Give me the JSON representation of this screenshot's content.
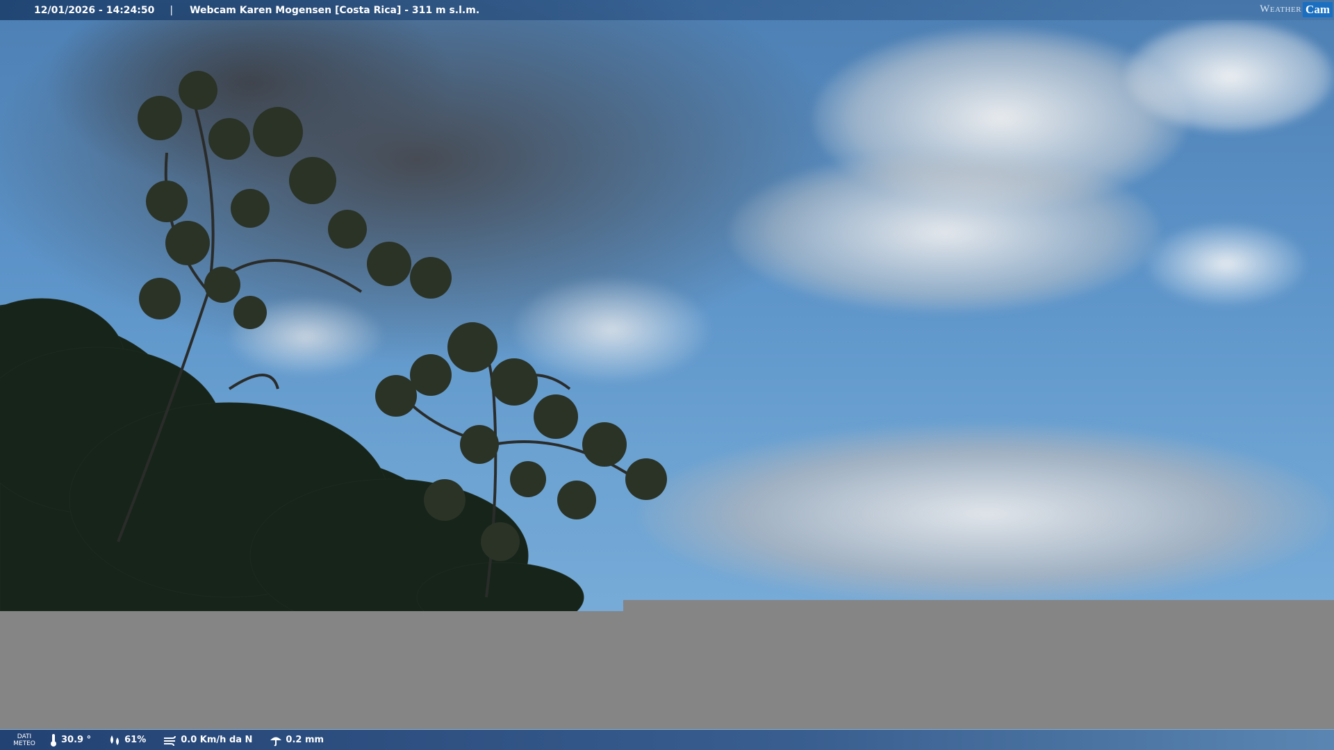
{
  "header": {
    "timestamp": "12/01/2026 - 14:24:50",
    "separator": "|",
    "title": "Webcam Karen Mogensen [Costa Rica] - 311 m s.l.m.",
    "logo_weather": "Weather",
    "logo_cam": "Cam"
  },
  "footer": {
    "label_line1": "DATI",
    "label_line2": "METEO",
    "temperature": "30.9 °",
    "humidity": "61%",
    "wind": "0.0 Km/h da N",
    "rain": "0.2 mm"
  },
  "icons": [
    "thermometer-icon",
    "humidity-icon",
    "wind-icon",
    "rain-icon"
  ]
}
